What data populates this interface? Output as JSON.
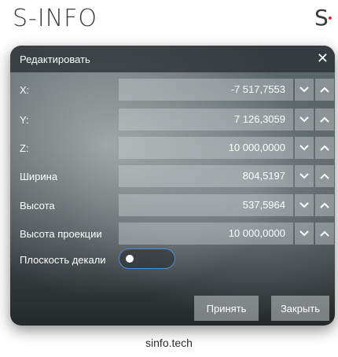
{
  "brand": {
    "name": "S-INFO",
    "logo_letter": "S",
    "logo_dot": "•"
  },
  "dialog": {
    "title": "Редактировать",
    "close_glyph": "✕",
    "fields": [
      {
        "label": "X:",
        "value": "-7 517,7553"
      },
      {
        "label": "Y:",
        "value": "7 126,3059"
      },
      {
        "label": "Z:",
        "value": "10 000,0000"
      },
      {
        "label": "Ширина",
        "value": "804,5197"
      },
      {
        "label": "Высота",
        "value": "537,5964"
      },
      {
        "label": "Высота проекции",
        "value": "10 000,0000"
      }
    ],
    "toggle": {
      "label": "Плоскость декали",
      "on": false
    },
    "accept_label": "Принять",
    "close_label": "Закрыть"
  },
  "footer": {
    "text": "sinfo.tech"
  },
  "colors": {
    "toggle_border": "#4d8fd6",
    "logo_dot": "#d9262c"
  }
}
